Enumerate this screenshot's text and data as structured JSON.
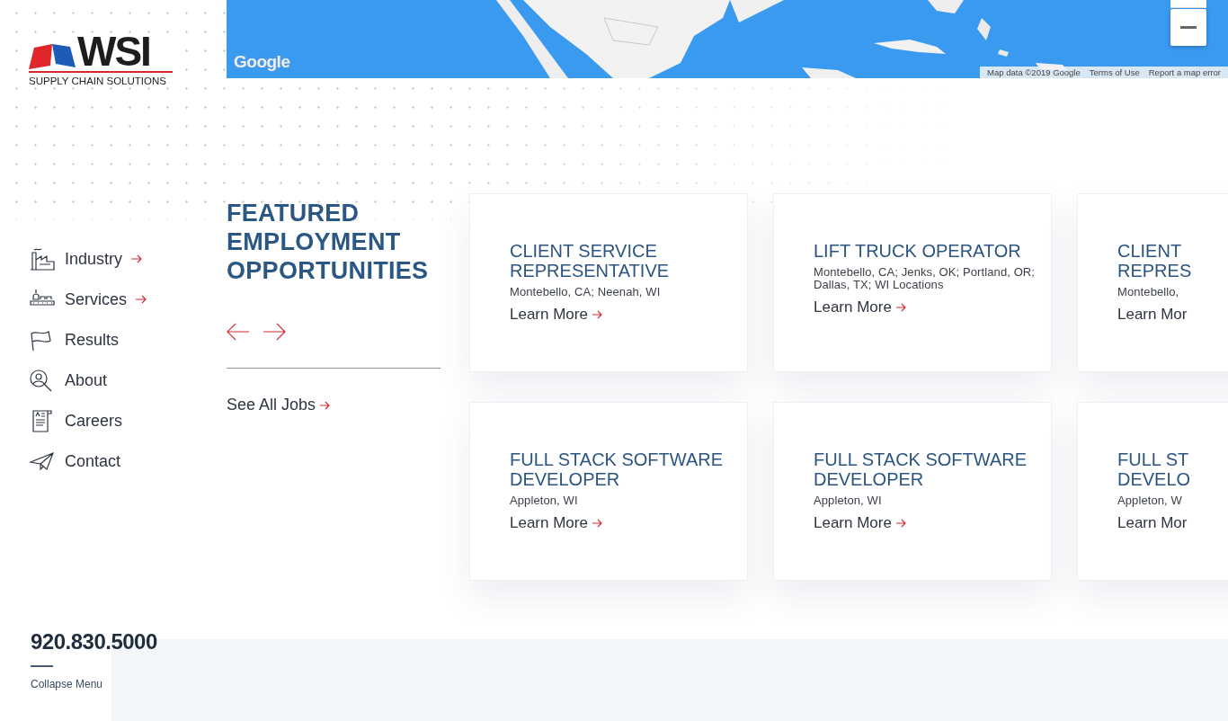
{
  "logo": {
    "name": "WSI",
    "tagline": "SUPPLY CHAIN SOLUTIONS"
  },
  "map": {
    "logo": "Google",
    "attribution": [
      "Map data ©2019 Google",
      "Terms of Use",
      "Report a map error"
    ]
  },
  "nav": [
    {
      "label": "Industry",
      "has_submenu": true
    },
    {
      "label": "Services",
      "has_submenu": true
    },
    {
      "label": "Results",
      "has_submenu": false
    },
    {
      "label": "About",
      "has_submenu": false
    },
    {
      "label": "Careers",
      "has_submenu": false
    },
    {
      "label": "Contact",
      "has_submenu": false
    }
  ],
  "featured": {
    "title": "FEATURED EMPLOYMENT OPPORTUNITIES",
    "see_all": "See All Jobs"
  },
  "jobs": [
    {
      "title_lines": [
        "CLIENT SERVICE",
        "REPRESENTATIVE"
      ],
      "location": "Montebello, CA; Neenah, WI",
      "link": "Learn More",
      "arrow": true
    },
    {
      "title_lines": [
        "LIFT TRUCK OPERATOR"
      ],
      "location": "Montebello, CA; Jenks, OK; Portland, OR; Dallas, TX; WI Locations",
      "link": "Learn More",
      "arrow": true
    },
    {
      "title_lines": [
        "CLIENT",
        "REPRES"
      ],
      "location": "Montebello,",
      "link": "Learn Mor",
      "arrow": false
    },
    {
      "title_lines": [
        "FULL STACK SOFTWARE",
        "DEVELOPER"
      ],
      "location": "Appleton, WI",
      "link": "Learn More",
      "arrow": true
    },
    {
      "title_lines": [
        "FULL STACK SOFTWARE",
        "DEVELOPER"
      ],
      "location": "Appleton, WI",
      "link": "Learn More",
      "arrow": true
    },
    {
      "title_lines": [
        "FULL ST",
        "DEVELO"
      ],
      "location": "Appleton, W",
      "link": "Learn Mor",
      "arrow": false
    }
  ],
  "footer": {
    "phone": "920.830.5000",
    "collapse": "Collapse Menu"
  }
}
